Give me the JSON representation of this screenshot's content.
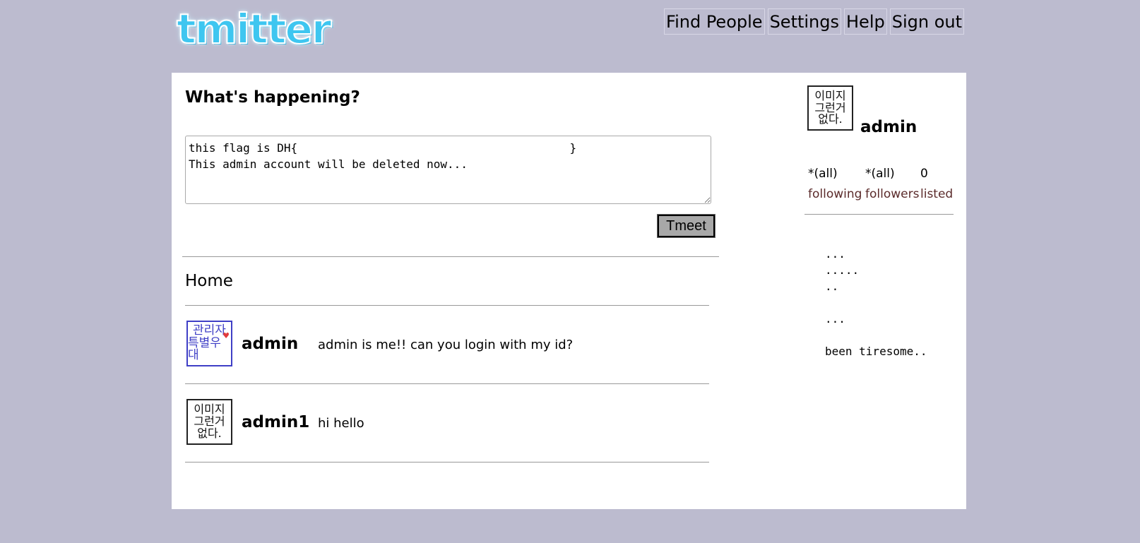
{
  "header": {
    "logo_text": "tmitter",
    "nav": [
      "Find People",
      "Settings",
      "Help",
      "Sign out"
    ]
  },
  "compose": {
    "heading": "What's happening?",
    "text": "this flag is DH{                                        }\nThis admin account will be deleted now...",
    "button_label": "Tmeet"
  },
  "home": {
    "heading": "Home",
    "items": [
      {
        "avatar_text": [
          "관리자",
          "특별우대"
        ],
        "avatar_style": "blue",
        "name": "admin",
        "text": "admin is me!! can you login with my id?"
      },
      {
        "avatar_text": [
          "이미지",
          "그런거",
          "없다."
        ],
        "avatar_style": "black",
        "name": "admin1",
        "text": "hi hello"
      }
    ]
  },
  "sidebar": {
    "avatar_text": [
      "이미지",
      "그런거",
      "없다."
    ],
    "name": "admin",
    "stats": [
      {
        "value": "*(all)",
        "label": "following"
      },
      {
        "value": "*(all)",
        "label": "followers"
      },
      {
        "value": "0",
        "label": "listed"
      }
    ],
    "list": [
      "...",
      ".....",
      "..",
      "",
      "...",
      "",
      "been tiresome.."
    ]
  },
  "colors": {
    "background": "#bcbbcf",
    "logo": "#3ec6f0",
    "stat_label": "#5b2b2b",
    "avatar_blue": "#3f3fc6"
  },
  "icons": {
    "resize_handle": "resize-grip-icon"
  }
}
